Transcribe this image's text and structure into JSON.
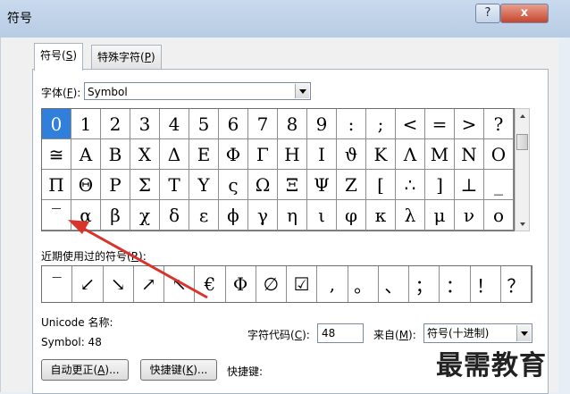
{
  "window": {
    "title": "符号",
    "help_label": "?",
    "close_label": "x"
  },
  "tabs": [
    {
      "label": "符号(",
      "key": "S",
      "end": ")"
    },
    {
      "label": "特殊字符(",
      "key": "P",
      "end": ")"
    }
  ],
  "font": {
    "label_pre": "字体(",
    "key": "F",
    "label_post": "):",
    "value": "Symbol"
  },
  "symbols": [
    [
      "0",
      "1",
      "2",
      "3",
      "4",
      "5",
      "6",
      "7",
      "8",
      "9",
      ":",
      ";",
      "<",
      "=",
      ">",
      "?"
    ],
    [
      "≅",
      "Α",
      "Β",
      "Χ",
      "Δ",
      "Ε",
      "Φ",
      "Γ",
      "Η",
      "Ι",
      "ϑ",
      "Κ",
      "Λ",
      "Μ",
      "Ν",
      "Ο"
    ],
    [
      "Π",
      "Θ",
      "Ρ",
      "Σ",
      "Τ",
      "Υ",
      "ς",
      "Ω",
      "Ξ",
      "Ψ",
      "Ζ",
      "[",
      "∴",
      "]",
      "⊥",
      "_"
    ],
    [
      "‾",
      "α",
      "β",
      "χ",
      "δ",
      "ε",
      "ϕ",
      "γ",
      "η",
      "ι",
      "φ",
      "κ",
      "λ",
      "μ",
      "ν",
      "ο"
    ]
  ],
  "selected_symbol": "0",
  "recent": {
    "label_pre": "近期使用过的符号(",
    "key": "R",
    "label_post": "):",
    "items": [
      "‾",
      "↙",
      "↘",
      "↗",
      "↖",
      "€",
      "Φ",
      "∅",
      "☑",
      ",",
      "。",
      "、",
      "；",
      "：",
      "！",
      "？"
    ]
  },
  "unicode_name_label": "Unicode 名称:",
  "symbol_info": "Symbol: 48",
  "char_code": {
    "label_pre": "字符代码(",
    "key": "C",
    "label_post": "):",
    "value": "48"
  },
  "from": {
    "label_pre": "来自(",
    "key": "M",
    "label_post": "):",
    "value": "符号(十进制)"
  },
  "buttons": {
    "autocorrect": {
      "pre": "自动更正(",
      "key": "A",
      "post": ")..."
    },
    "shortcut": {
      "pre": "快捷键(",
      "key": "K",
      "post": ")..."
    }
  },
  "shortcut_label": "快捷键:",
  "watermark": "最需教育",
  "colors": {
    "selected": "#2f7fdb",
    "arrow": "#d9342b"
  }
}
